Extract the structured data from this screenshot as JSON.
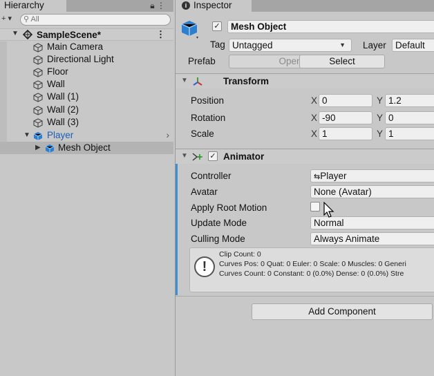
{
  "hierarchy": {
    "tab_label": "Hierarchy",
    "search_placeholder": "All",
    "add_symbol": "+ ▾",
    "scene": {
      "name": "SampleScene*"
    },
    "items": [
      {
        "label": "Main Camera"
      },
      {
        "label": "Directional Light"
      },
      {
        "label": "Floor"
      },
      {
        "label": "Wall"
      },
      {
        "label": "Wall (1)"
      },
      {
        "label": "Wall (2)"
      },
      {
        "label": "Wall (3)"
      },
      {
        "label": "Player"
      },
      {
        "label": "Mesh Object"
      }
    ]
  },
  "inspector": {
    "tab_label": "Inspector",
    "object": {
      "active_check": "✓",
      "name": "Mesh Object",
      "tag_label": "Tag",
      "tag_value": "Untagged",
      "layer_label": "Layer",
      "layer_value": "Default",
      "prefab_label": "Prefab",
      "prefab_open": "Open",
      "prefab_select": "Select"
    },
    "transform": {
      "title": "Transform",
      "position_label": "Position",
      "rotation_label": "Rotation",
      "scale_label": "Scale",
      "x_axis": "X",
      "y_axis": "Y",
      "position": {
        "x": "0",
        "y": "1.2"
      },
      "rotation": {
        "x": "-90",
        "y": "0"
      },
      "scale": {
        "x": "1",
        "y": "1"
      }
    },
    "animator": {
      "title": "Animator",
      "enabled_check": "✓",
      "controller_label": "Controller",
      "controller_value": "Player",
      "avatar_label": "Avatar",
      "avatar_value": "None (Avatar)",
      "root_motion_label": "Apply Root Motion",
      "update_mode_label": "Update Mode",
      "update_mode_value": "Normal",
      "culling_mode_label": "Culling Mode",
      "culling_mode_value": "Always Animate",
      "info_lines": [
        "Clip Count: 0",
        "Curves Pos: 0 Quat: 0 Euler: 0 Scale: 0 Muscles: 0 Generi",
        "Curves Count: 0 Constant: 0 (0.0%) Dense: 0 (0.0%) Stre"
      ]
    },
    "add_component": "Add Component"
  },
  "colors": {
    "selection_text": "#1a5fb4",
    "accent": "#3a8fd6",
    "panel_bg": "#c8c8c8"
  },
  "icons": [
    "search-icon",
    "unity-scene-icon",
    "gameobject-icon",
    "cube-icon",
    "lock-icon",
    "menu-dots-icon",
    "transform-axes-icon",
    "animator-icon",
    "warning-icon",
    "controller-icon"
  ]
}
